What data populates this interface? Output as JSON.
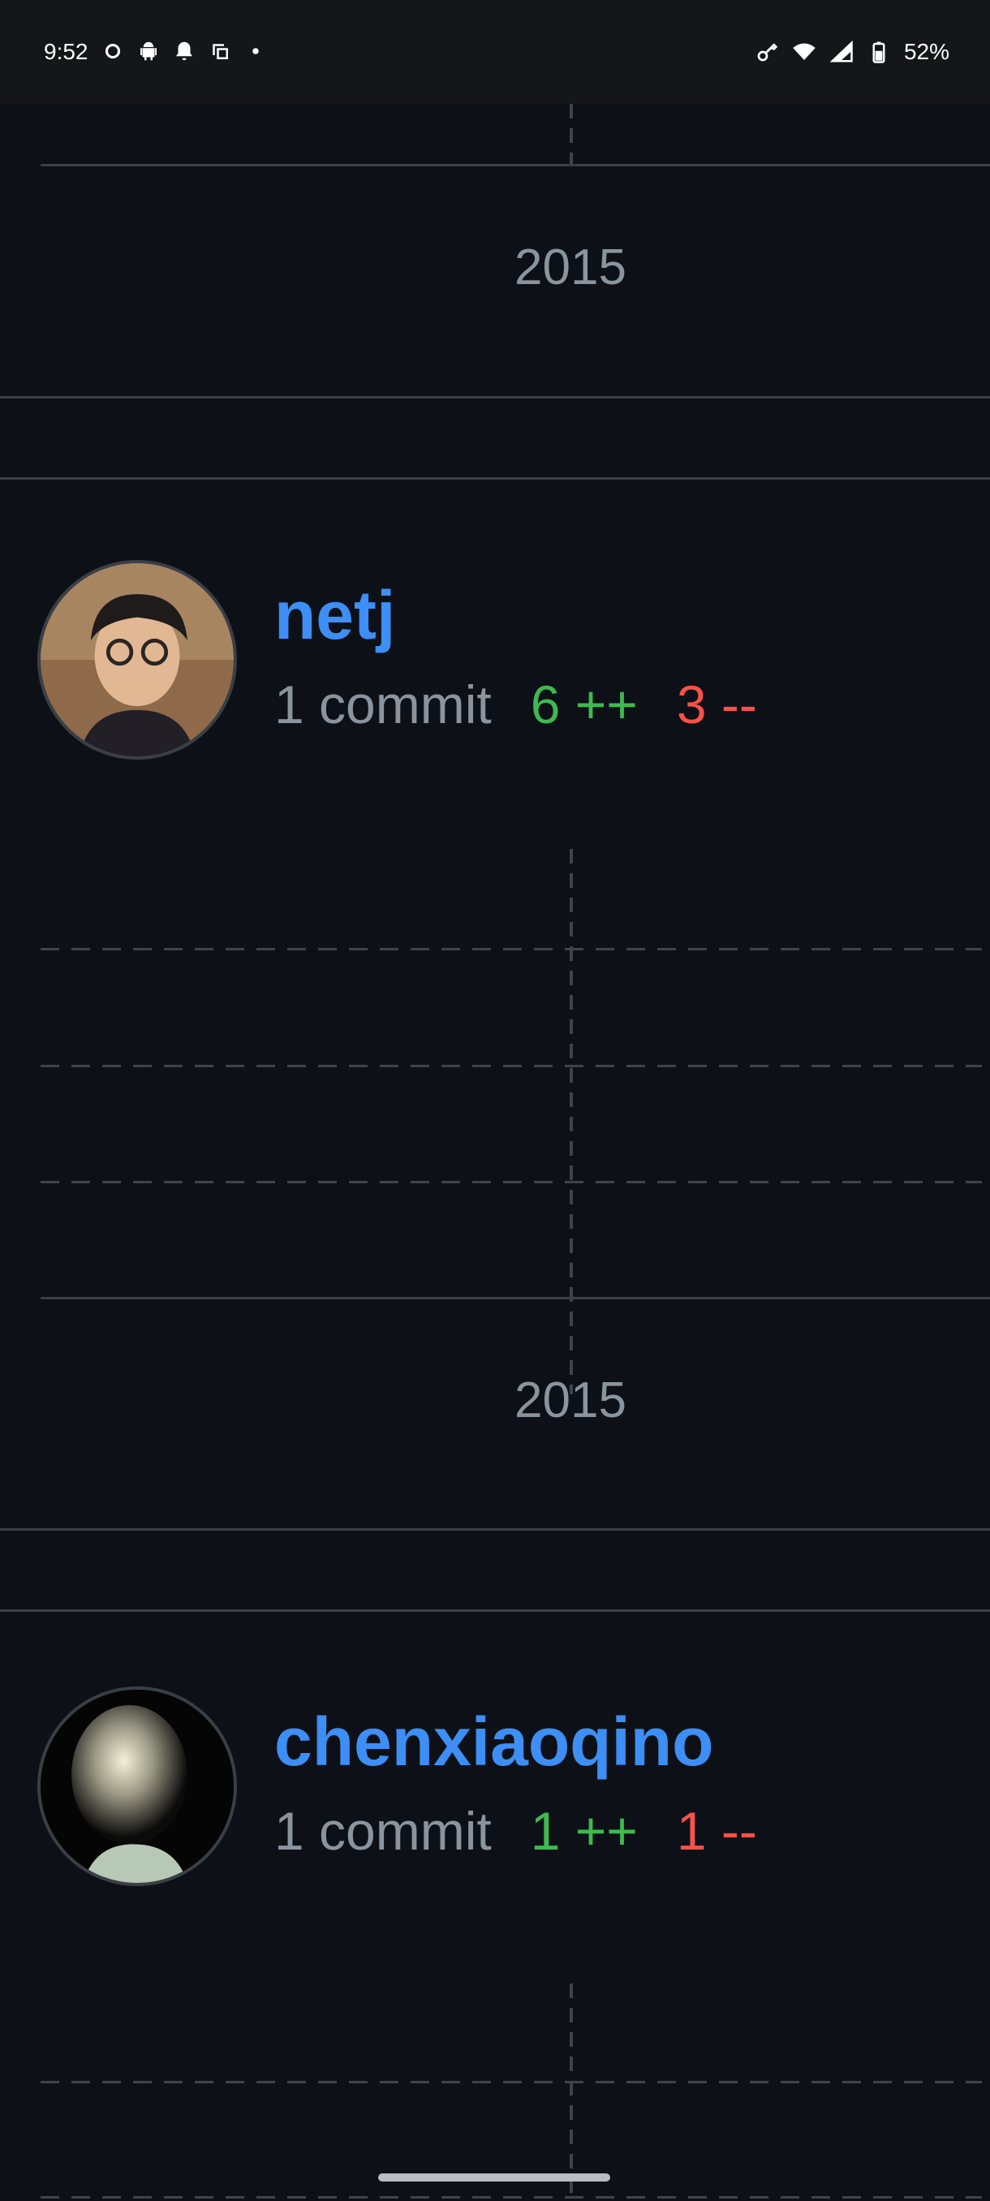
{
  "status_bar": {
    "time": "9:52",
    "battery_percent": "52%",
    "left_icons": [
      "vpn-ring-icon",
      "android-icon",
      "bell-icon",
      "screenshot-icon",
      "dot-icon"
    ],
    "right_icons": [
      "key-icon",
      "wifi-icon",
      "signal-icon",
      "battery-icon"
    ]
  },
  "timeline": [
    {
      "year": "2015"
    },
    {
      "year": "2015"
    }
  ],
  "contributors": [
    {
      "name": "netj",
      "commits": "1 commit",
      "additions": "6 ++",
      "deletions": "3 --"
    },
    {
      "name": "chenxiaoqino",
      "commits": "1 commit",
      "additions": "1 ++",
      "deletions": "1 --"
    }
  ],
  "colors": {
    "background": "#0d1117",
    "name": "#3d8ef5",
    "additions": "#3fb950",
    "deletions": "#f85149",
    "muted": "#8b949e"
  }
}
